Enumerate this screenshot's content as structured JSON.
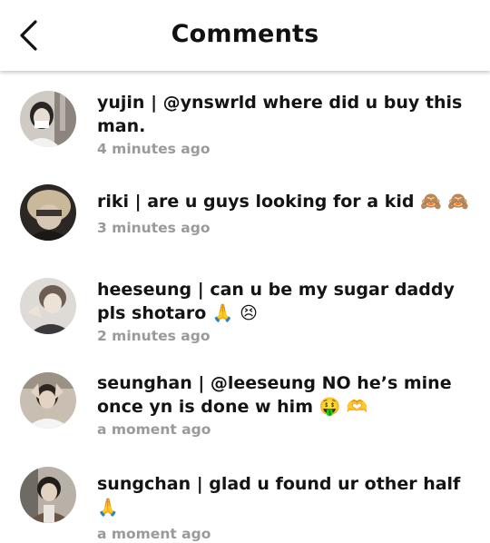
{
  "header": {
    "title": "Comments"
  },
  "comments": [
    {
      "text": "yujin | @ynswrld where did u buy this man.",
      "time": "4 minutes ago"
    },
    {
      "text": "riki | are u guys looking for a kid 🙈 🙈",
      "time": "3 minutes ago"
    },
    {
      "text": "heeseung | can u be my sugar daddy pls shotaro 🙏 😣",
      "time": "2 minutes ago"
    },
    {
      "text": "seunghan | @leeseung NO he’s mine once yn is done w him 🤑 🫶",
      "time": "a moment ago"
    },
    {
      "text": "sungchan | glad u found ur other half 🙏",
      "time": "a moment ago"
    }
  ]
}
